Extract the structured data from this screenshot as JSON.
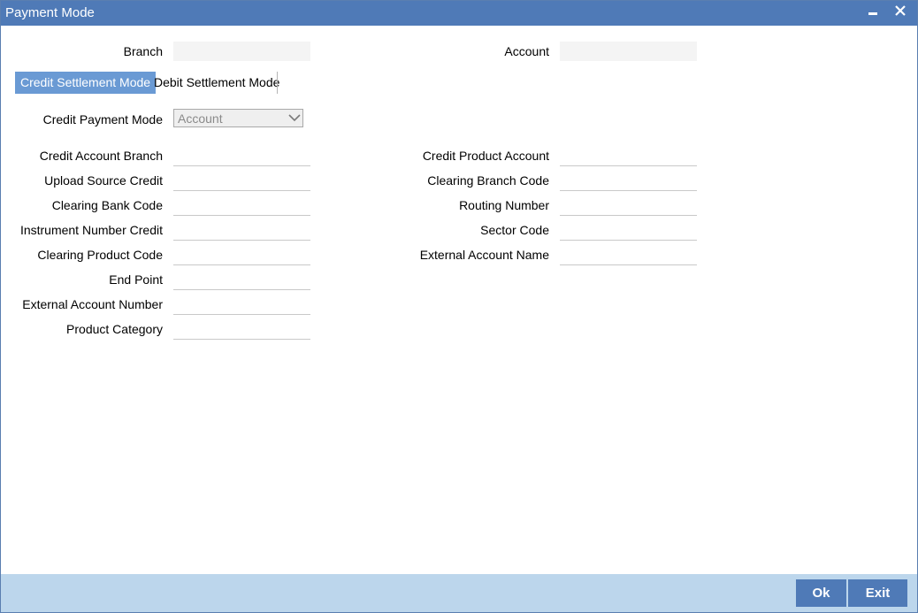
{
  "window": {
    "title": "Payment Mode",
    "minimize_icon": "minimize-icon",
    "close_icon": "close-icon"
  },
  "header": {
    "branch_label": "Branch",
    "branch_value": "",
    "account_label": "Account",
    "account_value": ""
  },
  "tabs": [
    {
      "label": "Credit Settlement Mode",
      "active": true
    },
    {
      "label": "Debit Settlement Mode",
      "active": false
    }
  ],
  "payment_mode": {
    "label": "Credit Payment Mode",
    "selected": "Account"
  },
  "left_fields": [
    {
      "label": "Credit Account Branch",
      "value": ""
    },
    {
      "label": "Upload Source Credit",
      "value": ""
    },
    {
      "label": "Clearing Bank Code",
      "value": ""
    },
    {
      "label": "Instrument Number Credit",
      "value": ""
    },
    {
      "label": "Clearing Product Code",
      "value": ""
    },
    {
      "label": "End Point",
      "value": ""
    },
    {
      "label": "External Account Number",
      "value": ""
    },
    {
      "label": "Product Category",
      "value": ""
    }
  ],
  "right_fields": [
    {
      "label": "Credit Product Account",
      "value": ""
    },
    {
      "label": "Clearing Branch Code",
      "value": ""
    },
    {
      "label": "Routing Number",
      "value": ""
    },
    {
      "label": "Sector Code",
      "value": ""
    },
    {
      "label": "External Account Name",
      "value": ""
    }
  ],
  "footer": {
    "ok_label": "Ok",
    "exit_label": "Exit"
  },
  "colors": {
    "titlebar": "#4f7ab7",
    "active_tab": "#6a9ad4",
    "footer": "#bcd6ec",
    "button": "#4f7ab7"
  }
}
